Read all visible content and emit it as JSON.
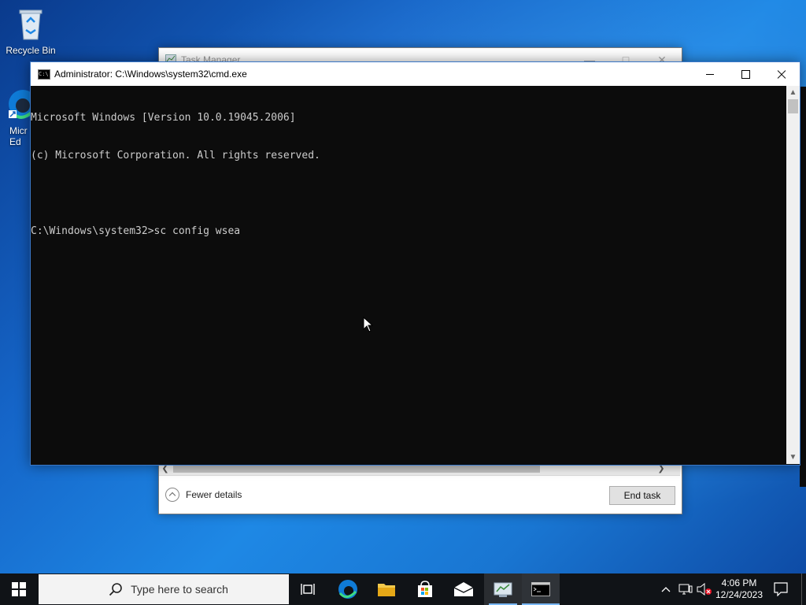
{
  "desktop": {
    "icons": [
      {
        "name": "recycle-bin",
        "label": "Recycle Bin"
      },
      {
        "name": "microsoft-edge",
        "label": "Micr\nEd"
      }
    ]
  },
  "task_manager": {
    "title": "Task Manager",
    "fewer_details": "Fewer details",
    "end_task": "End task"
  },
  "cmd": {
    "title": "Administrator: C:\\Windows\\system32\\cmd.exe",
    "lines": [
      "Microsoft Windows [Version 10.0.19045.2006]",
      "(c) Microsoft Corporation. All rights reserved.",
      "",
      "C:\\Windows\\system32>sc config wsea"
    ]
  },
  "taskbar": {
    "search_placeholder": "Type here to search",
    "apps": [
      "task-view",
      "edge",
      "file-explorer",
      "store",
      "mail",
      "task-manager",
      "cmd"
    ],
    "time": "4:06 PM",
    "date": "12/24/2023"
  },
  "colors": {
    "console_bg": "#0c0c0c",
    "console_fg": "#cccccc",
    "taskbar_bg": "#101317",
    "accent": "#7ab8f5"
  }
}
